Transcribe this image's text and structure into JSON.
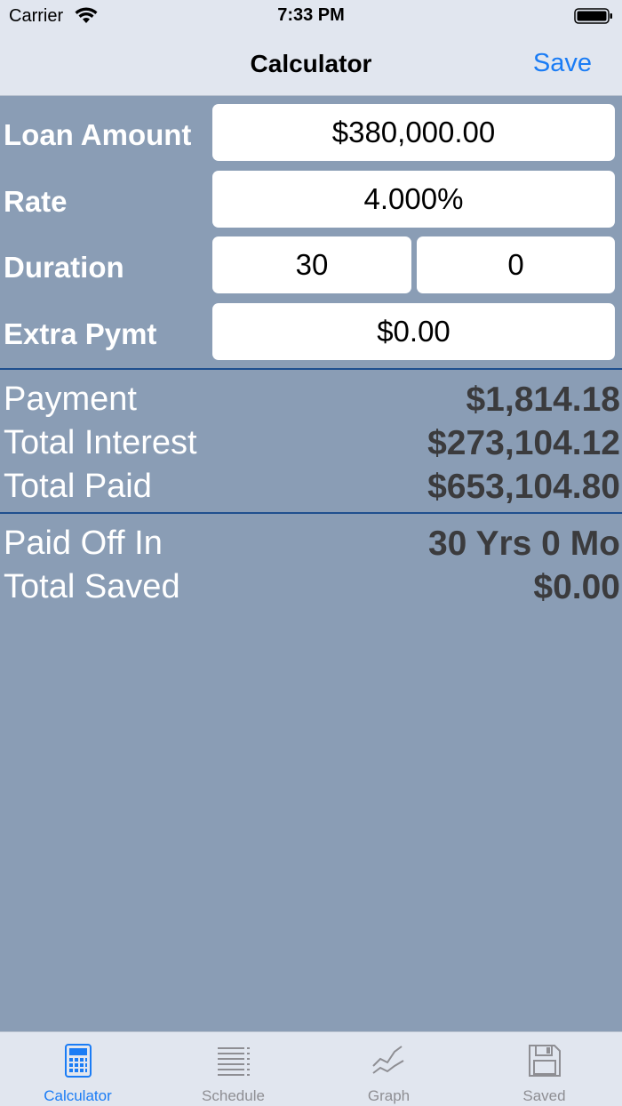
{
  "status_bar": {
    "carrier": "Carrier",
    "time": "7:33 PM"
  },
  "nav": {
    "title": "Calculator",
    "save_label": "Save"
  },
  "inputs": {
    "loan_amount": {
      "label": "Loan Amount",
      "value": "$380,000.00"
    },
    "rate": {
      "label": "Rate",
      "value": "4.000%"
    },
    "duration": {
      "label": "Duration",
      "years": "30",
      "months": "0"
    },
    "extra_payment": {
      "label": "Extra Pymt",
      "value": "$0.00"
    }
  },
  "results": {
    "payment": {
      "label": "Payment",
      "value": "$1,814.18"
    },
    "total_interest": {
      "label": "Total Interest",
      "value": "$273,104.12"
    },
    "total_paid": {
      "label": "Total Paid",
      "value": "$653,104.80"
    },
    "paid_off_in": {
      "label": "Paid Off In",
      "value": "30 Yrs 0 Mo"
    },
    "total_saved": {
      "label": "Total Saved",
      "value": "$0.00"
    }
  },
  "tabs": [
    {
      "label": "Calculator",
      "icon": "calculator-icon",
      "active": true
    },
    {
      "label": "Schedule",
      "icon": "list-icon",
      "active": false
    },
    {
      "label": "Graph",
      "icon": "graph-icon",
      "active": false
    },
    {
      "label": "Saved",
      "icon": "floppy-disk-icon",
      "active": false
    }
  ],
  "colors": {
    "background": "#8a9db5",
    "bar_background": "#e1e6ef",
    "accent": "#1a7cf5",
    "divider": "#1f4f8e",
    "value_text": "#3b3b3d"
  }
}
